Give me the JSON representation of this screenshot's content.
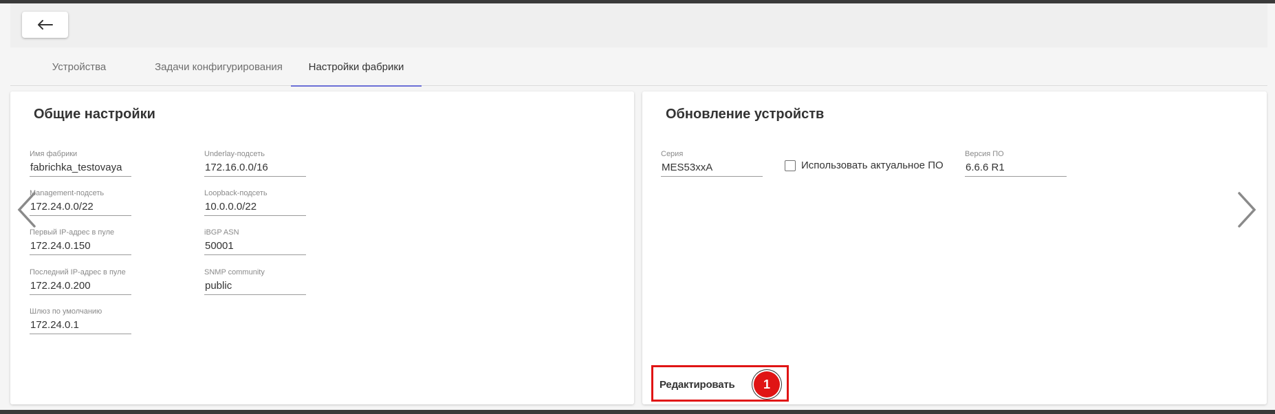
{
  "header": {
    "back_icon": "arrow-left-icon"
  },
  "tabs": [
    {
      "label": "Устройства",
      "active": false
    },
    {
      "label": "Задачи конфигурирования",
      "active": false
    },
    {
      "label": "Настройки фабрики",
      "active": true
    }
  ],
  "general": {
    "title": "Общие настройки",
    "fields": [
      {
        "label": "Имя фабрики",
        "value": "fabrichka_testovaya"
      },
      {
        "label": "Management-подсеть",
        "value": "172.24.0.0/22"
      },
      {
        "label": "Первый IP-адрес в пуле",
        "value": "172.24.0.150"
      },
      {
        "label": "Последний IP-адрес в пуле",
        "value": "172.24.0.200"
      },
      {
        "label": "Шлюз по умолчанию",
        "value": "172.24.0.1"
      },
      {
        "label": "Underlay-подсеть",
        "value": "172.16.0.0/16"
      },
      {
        "label": "Loopback-подсеть",
        "value": "10.0.0.0/22"
      },
      {
        "label": "iBGP ASN",
        "value": "50001"
      },
      {
        "label": "SNMP community",
        "value": "public"
      }
    ]
  },
  "update": {
    "title": "Обновление устройств",
    "series_label": "Серия",
    "series_value": "MES53xxA",
    "use_latest_label": "Использовать актуальное ПО",
    "use_latest_checked": false,
    "version_label": "Версия ПО",
    "version_value": "6.6.6 R1",
    "edit_label": "Редактировать",
    "badge": "1"
  },
  "colors": {
    "tab_indicator": "#6b6fd6",
    "highlight": "#e01414"
  }
}
